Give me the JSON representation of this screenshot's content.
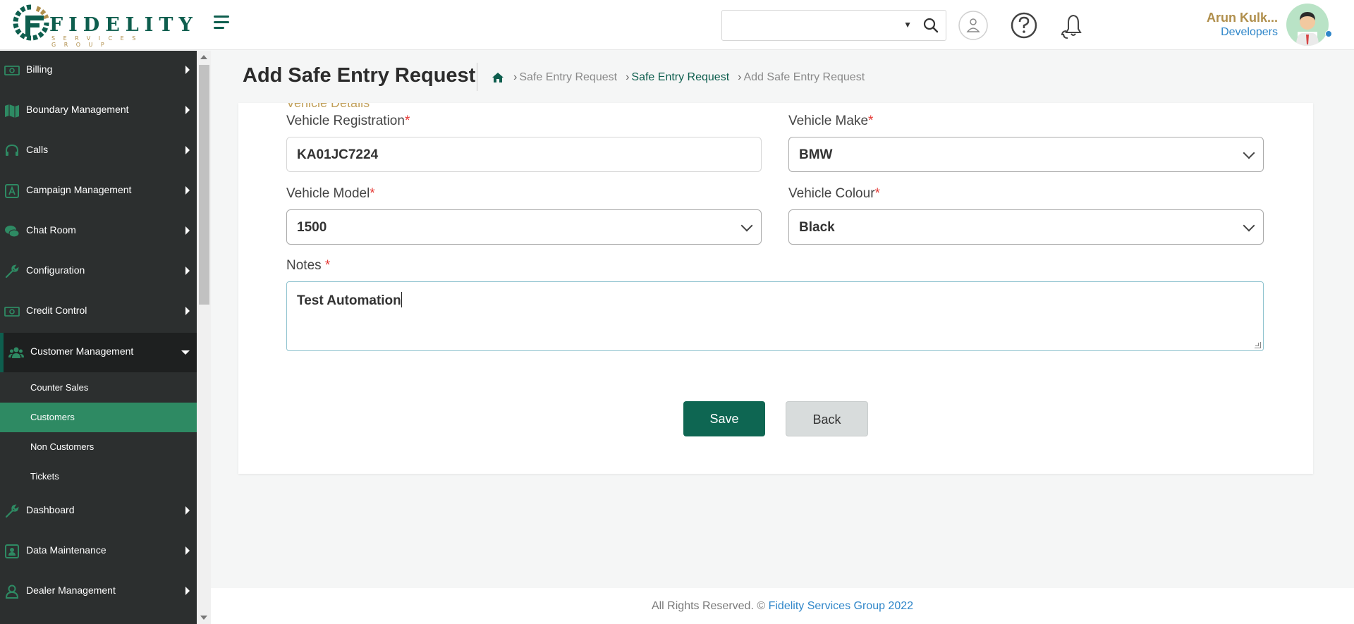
{
  "header": {
    "logo_text": "FIDELITY",
    "logo_subtext": "SERVICES GROUP",
    "search": {
      "value": "",
      "placeholder": ""
    },
    "user": {
      "name": "Arun Kulk...",
      "role": "Developers"
    }
  },
  "sidebar": {
    "items": [
      {
        "label": "Billing",
        "icon": "money-icon"
      },
      {
        "label": "Boundary Management",
        "icon": "map-icon"
      },
      {
        "label": "Calls",
        "icon": "headset-icon"
      },
      {
        "label": "Campaign Management",
        "icon": "campaign-icon"
      },
      {
        "label": "Chat Room",
        "icon": "chat-icon"
      },
      {
        "label": "Configuration",
        "icon": "wrench-icon"
      },
      {
        "label": "Credit Control",
        "icon": "money-icon"
      },
      {
        "label": "Customer Management",
        "icon": "users-icon",
        "expanded": true
      },
      {
        "label": "Dashboard",
        "icon": "wrench-icon"
      },
      {
        "label": "Data Maintenance",
        "icon": "id-card-icon"
      },
      {
        "label": "Dealer Management",
        "icon": "user-icon"
      }
    ],
    "sub_items": [
      {
        "label": "Counter Sales"
      },
      {
        "label": "Customers",
        "active": true
      },
      {
        "label": "Non Customers"
      },
      {
        "label": "Tickets"
      }
    ]
  },
  "page": {
    "title": "Add Safe Entry Request",
    "breadcrumb": [
      "Safe Entry Request",
      "Safe Entry Request",
      "Add Safe Entry Request"
    ]
  },
  "form": {
    "section_title": "Vehicle Details",
    "vehicle_registration": {
      "label": "Vehicle Registration",
      "value": "KA01JC7224"
    },
    "vehicle_make": {
      "label": "Vehicle Make",
      "value": "BMW"
    },
    "vehicle_model": {
      "label": "Vehicle Model",
      "value": "1500"
    },
    "vehicle_colour": {
      "label": "Vehicle Colour",
      "value": "Black"
    },
    "notes": {
      "label": "Notes",
      "value": "Test Automation"
    },
    "required_mark": "*",
    "save_label": "Save",
    "back_label": "Back"
  },
  "footer": {
    "text": "All Rights Reserved. ©",
    "company": "Fidelity Services Group 2022"
  },
  "colors": {
    "brand_green": "#0e5e4e",
    "brand_gold": "#b08f4c",
    "sidebar_bg": "#2c2f2f",
    "active_item": "#2e8a63",
    "required": "#e53935",
    "link_blue": "#2f86c9"
  }
}
